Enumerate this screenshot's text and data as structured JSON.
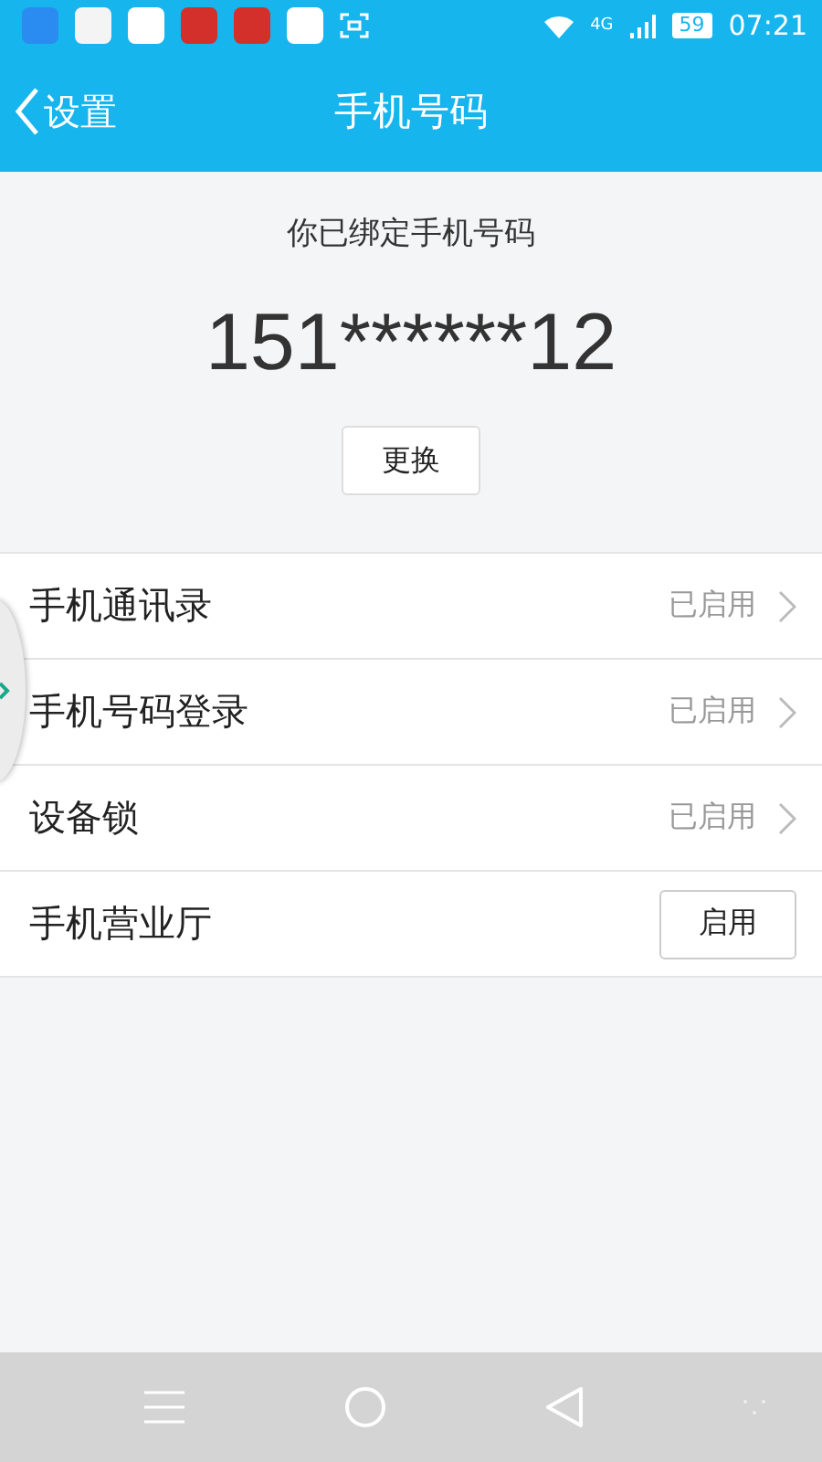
{
  "status_bar": {
    "network": "4G",
    "battery": "59",
    "time": "07:21"
  },
  "nav": {
    "back": "设置",
    "title": "手机号码"
  },
  "binding": {
    "label": "你已绑定手机号码",
    "number": "151******12",
    "button": "更换"
  },
  "rows": [
    {
      "kind": "link",
      "label": "手机通讯录",
      "status": "已启用"
    },
    {
      "kind": "link",
      "label": "手机号码登录",
      "status": "已启用"
    },
    {
      "kind": "link",
      "label": "设备锁",
      "status": "已启用"
    },
    {
      "kind": "button",
      "label": "手机营业厅",
      "action": "启用"
    }
  ]
}
